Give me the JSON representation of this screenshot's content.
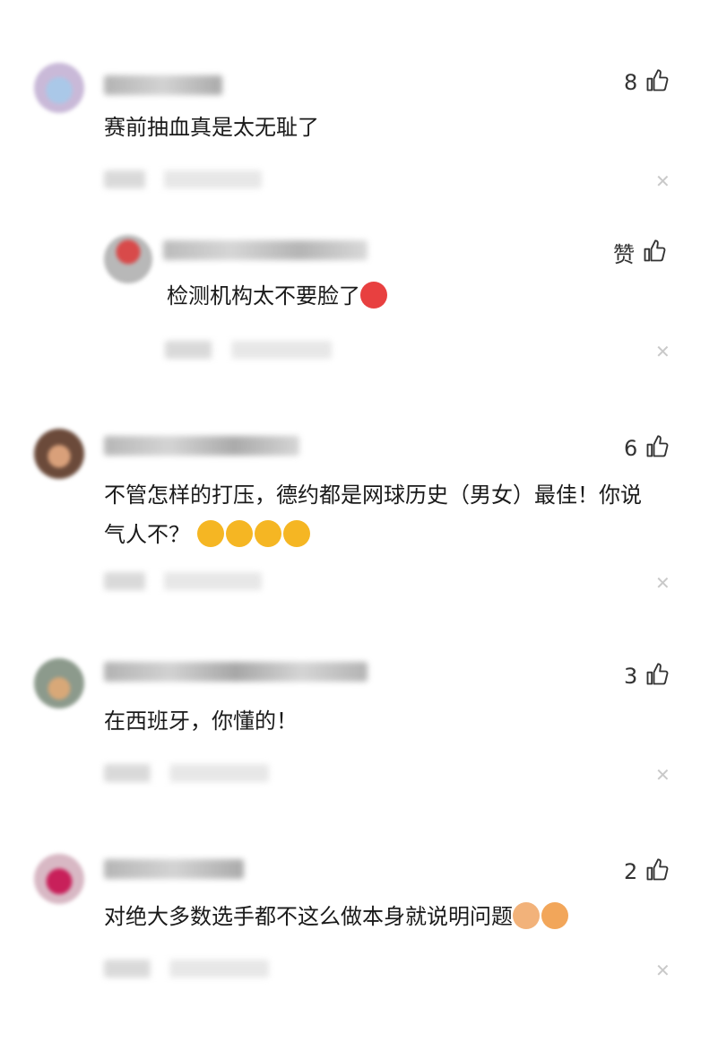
{
  "comments": [
    {
      "text": "赛前抽血真是太无耻了",
      "likes": "8"
    },
    {
      "text": "检测机构太不要脸了",
      "likes": "赞",
      "reply": true
    },
    {
      "text": "不管怎样的打压，德约都是网球历史（男女）最佳！你说",
      "text2": "气人不？",
      "likes": "6"
    },
    {
      "text": "在西班牙，你懂的！",
      "likes": "3"
    },
    {
      "text": "对绝大多数选手都不这么做本身就说明问题",
      "likes": "2"
    }
  ],
  "icons": {
    "like": "thumbs-up-icon",
    "close": "close-icon"
  },
  "colors": {
    "text": "#1a1a1a",
    "muted": "#c9c9c9",
    "emoji": "#f5b623",
    "angry": "#e84040"
  }
}
